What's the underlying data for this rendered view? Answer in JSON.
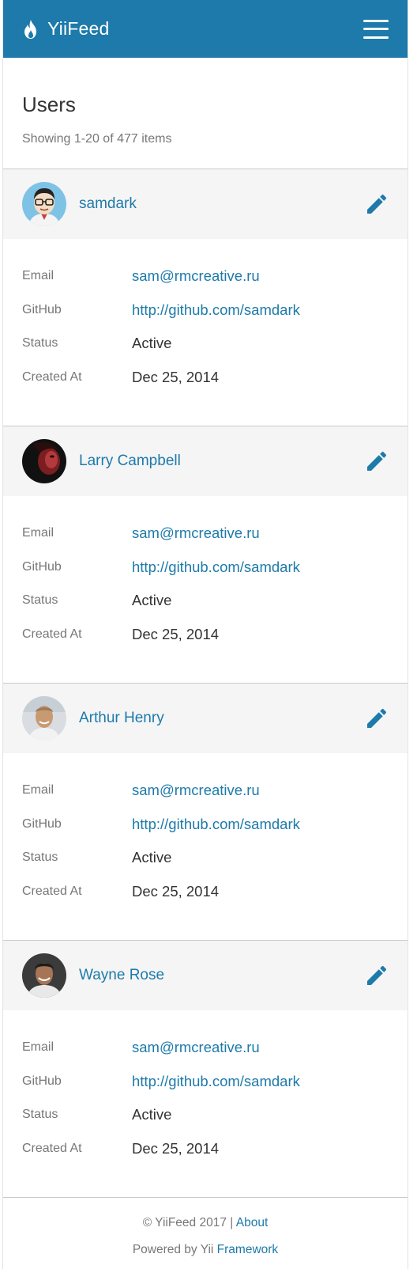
{
  "app": {
    "brand": "YiiFeed",
    "colors": {
      "primary": "#1d7aaa",
      "header_bg": "#f5f5f5",
      "muted": "#777777"
    }
  },
  "page": {
    "title": "Users",
    "summary": "Showing 1-20 of 477 items"
  },
  "labels": {
    "email": "Email",
    "github": "GitHub",
    "status": "Status",
    "created_at": "Created At"
  },
  "users": [
    {
      "name": "samdark",
      "email": "sam@rmcreative.ru",
      "github": "http://github.com/samdark",
      "status": "Active",
      "created_at": "Dec 25, 2014"
    },
    {
      "name": "Larry Campbell",
      "email": "sam@rmcreative.ru",
      "github": "http://github.com/samdark",
      "status": "Active",
      "created_at": "Dec 25, 2014"
    },
    {
      "name": "Arthur Henry",
      "email": "sam@rmcreative.ru",
      "github": "http://github.com/samdark",
      "status": "Active",
      "created_at": "Dec 25, 2014"
    },
    {
      "name": "Wayne Rose",
      "email": "sam@rmcreative.ru",
      "github": "http://github.com/samdark",
      "status": "Active",
      "created_at": "Dec 25, 2014"
    }
  ],
  "footer": {
    "copyright": "© YiiFeed 2017 |",
    "about": "About",
    "powered_prefix": "Powered by Yii",
    "framework": "Framework"
  },
  "icons": {
    "brand": "flame-icon",
    "menu": "hamburger-menu-icon",
    "edit": "pencil-icon"
  }
}
